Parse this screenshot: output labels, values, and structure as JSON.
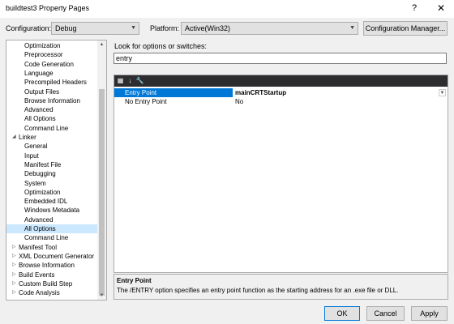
{
  "window": {
    "title": "buildtest3 Property Pages",
    "help": "?",
    "close": "✕"
  },
  "config": {
    "configuration_label": "Configuration:",
    "configuration_value": "Debug",
    "platform_label": "Platform:",
    "platform_value": "Active(Win32)",
    "manager_button": "Configuration Manager..."
  },
  "tree": {
    "items": [
      {
        "label": "Optimization",
        "level": 2,
        "expander": ""
      },
      {
        "label": "Preprocessor",
        "level": 2,
        "expander": ""
      },
      {
        "label": "Code Generation",
        "level": 2,
        "expander": ""
      },
      {
        "label": "Language",
        "level": 2,
        "expander": ""
      },
      {
        "label": "Precompiled Headers",
        "level": 2,
        "expander": ""
      },
      {
        "label": "Output Files",
        "level": 2,
        "expander": ""
      },
      {
        "label": "Browse Information",
        "level": 2,
        "expander": ""
      },
      {
        "label": "Advanced",
        "level": 2,
        "expander": ""
      },
      {
        "label": "All Options",
        "level": 2,
        "expander": ""
      },
      {
        "label": "Command Line",
        "level": 2,
        "expander": ""
      },
      {
        "label": "Linker",
        "level": 1,
        "expander": "◢"
      },
      {
        "label": "General",
        "level": 2,
        "expander": ""
      },
      {
        "label": "Input",
        "level": 2,
        "expander": ""
      },
      {
        "label": "Manifest File",
        "level": 2,
        "expander": ""
      },
      {
        "label": "Debugging",
        "level": 2,
        "expander": ""
      },
      {
        "label": "System",
        "level": 2,
        "expander": ""
      },
      {
        "label": "Optimization",
        "level": 2,
        "expander": ""
      },
      {
        "label": "Embedded IDL",
        "level": 2,
        "expander": ""
      },
      {
        "label": "Windows Metadata",
        "level": 2,
        "expander": ""
      },
      {
        "label": "Advanced",
        "level": 2,
        "expander": ""
      },
      {
        "label": "All Options",
        "level": 2,
        "expander": "",
        "selected": true
      },
      {
        "label": "Command Line",
        "level": 2,
        "expander": ""
      },
      {
        "label": "Manifest Tool",
        "level": 1,
        "expander": "▷"
      },
      {
        "label": "XML Document Generator",
        "level": 1,
        "expander": "▷"
      },
      {
        "label": "Browse Information",
        "level": 1,
        "expander": "▷"
      },
      {
        "label": "Build Events",
        "level": 1,
        "expander": "▷"
      },
      {
        "label": "Custom Build Step",
        "level": 1,
        "expander": "▷"
      },
      {
        "label": "Code Analysis",
        "level": 1,
        "expander": "▷"
      }
    ],
    "scroll_up": "▲",
    "scroll_down": "▼"
  },
  "search": {
    "label": "Look for options or switches:",
    "value": "entry"
  },
  "grid": {
    "toolbar_icons": [
      "categorized-icon",
      "alphabetical-icon",
      "property-pages-icon"
    ],
    "toolbar_glyphs": [
      "▦",
      "↓",
      "🔧"
    ],
    "rows": [
      {
        "name": "Entry Point",
        "value": "mainCRTStartup",
        "selected": true
      },
      {
        "name": "No Entry Point",
        "value": "No",
        "selected": false
      }
    ],
    "dropdown": "▼"
  },
  "description": {
    "title": "Entry Point",
    "text": "The /ENTRY option specifies an entry point function as the starting address for an .exe file or DLL."
  },
  "buttons": {
    "ok": "OK",
    "cancel": "Cancel",
    "apply": "Apply"
  }
}
